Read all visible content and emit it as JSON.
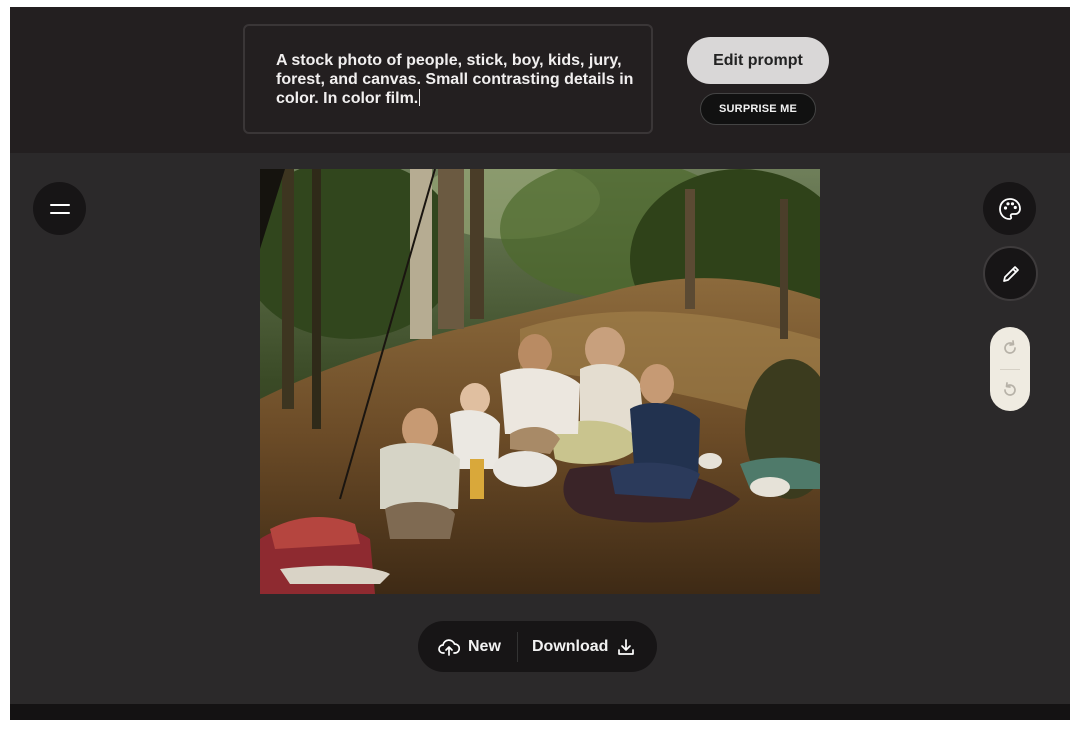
{
  "prompt": {
    "text": "A stock photo of  people, stick, boy, kids, jury, forest, and canvas. Small contrasting details in color. In color film."
  },
  "buttons": {
    "edit_prompt": "Edit prompt",
    "surprise_me": "SURPRISE ME",
    "new": "New",
    "download": "Download"
  },
  "icons": {
    "menu": "hamburger-menu-icon",
    "palette": "palette-icon",
    "pencil": "pencil-icon",
    "redo": "redo-icon",
    "undo": "undo-icon",
    "upload": "cloud-upload-icon",
    "download": "download-icon"
  },
  "image": {
    "content": "colorized family picnic photo in a forest"
  },
  "colors": {
    "background": "#2b292a",
    "topbar": "#231f20",
    "button_dark": "#171516",
    "edit_button": "#d9d7d7",
    "undo_stack": "#efebe1"
  }
}
